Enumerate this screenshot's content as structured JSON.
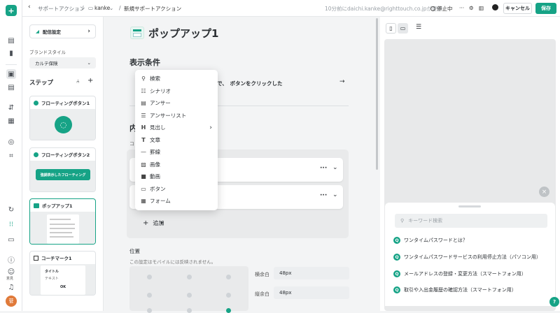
{
  "header": {
    "breadcrumb_1": "サポートアクション",
    "breadcrumb_2": "kanke",
    "breadcrumb_3": "新規サポートアクション",
    "updated_text": "10分前にdaichi.kanke@righttouch.co.jpが更新",
    "status": "停止中",
    "cancel_label": "キャンセル",
    "save_label": "保存"
  },
  "steps_panel": {
    "settings_button": "配信設定",
    "brand_style_label": "ブランドスタイル",
    "brand_style_value": "カルテ保険",
    "steps_title": "ステップ",
    "cards": [
      {
        "title": "フローティングボタン1"
      },
      {
        "title": "フローティングボタン2",
        "body_button": "強調表示したフローティング"
      },
      {
        "title": "ポップアップ1"
      },
      {
        "title": "コーチマーク1",
        "body_title": "タイトル",
        "body_text": "テキスト",
        "body_button": "OK"
      }
    ]
  },
  "editor": {
    "page_title": "ポップアップ1",
    "display_condition_heading": "表示条件",
    "condition_text": "で、　ボタンをクリックした",
    "content_heading_partial": "内",
    "content_sub_partial": "コ",
    "add_label": "追加",
    "position_heading": "位置",
    "position_note": "この設定はモバイルには反映されません。",
    "h_margin_label": "横余白",
    "h_margin_value": "48px",
    "v_margin_label": "縦余白",
    "v_margin_value": "48px"
  },
  "dropdown": {
    "items": [
      {
        "label": "検索",
        "icon": "search-icon"
      },
      {
        "label": "シナリオ",
        "icon": "scenario-icon"
      },
      {
        "label": "アンサー",
        "icon": "answer-icon"
      },
      {
        "label": "アンサーリスト",
        "icon": "list-icon"
      },
      {
        "label": "見出し",
        "icon": "heading-icon"
      },
      {
        "label": "文章",
        "icon": "text-icon"
      },
      {
        "label": "罫線",
        "icon": "divider-icon"
      },
      {
        "label": "画像",
        "icon": "image-icon"
      },
      {
        "label": "動画",
        "icon": "video-icon"
      },
      {
        "label": "ボタン",
        "icon": "button-icon"
      },
      {
        "label": "フォーム",
        "icon": "form-icon"
      }
    ]
  },
  "preview": {
    "search_placeholder": "キーワード検索",
    "faq": [
      "ワンタイムパスワードとは？",
      "ワンタイムパスワードサービスの利用停止方法（パソコン用）",
      "メールアドレスの登録・変更方法（スマートフォン用）",
      "取引や入出金履歴の確認方法（スマートフォン用）"
    ],
    "help_label": "?"
  },
  "rail": {
    "feedback_label": "意見",
    "avatar_initial": "菅"
  },
  "colors": {
    "accent": "#16a386",
    "canvas": "#e8e9ea"
  }
}
